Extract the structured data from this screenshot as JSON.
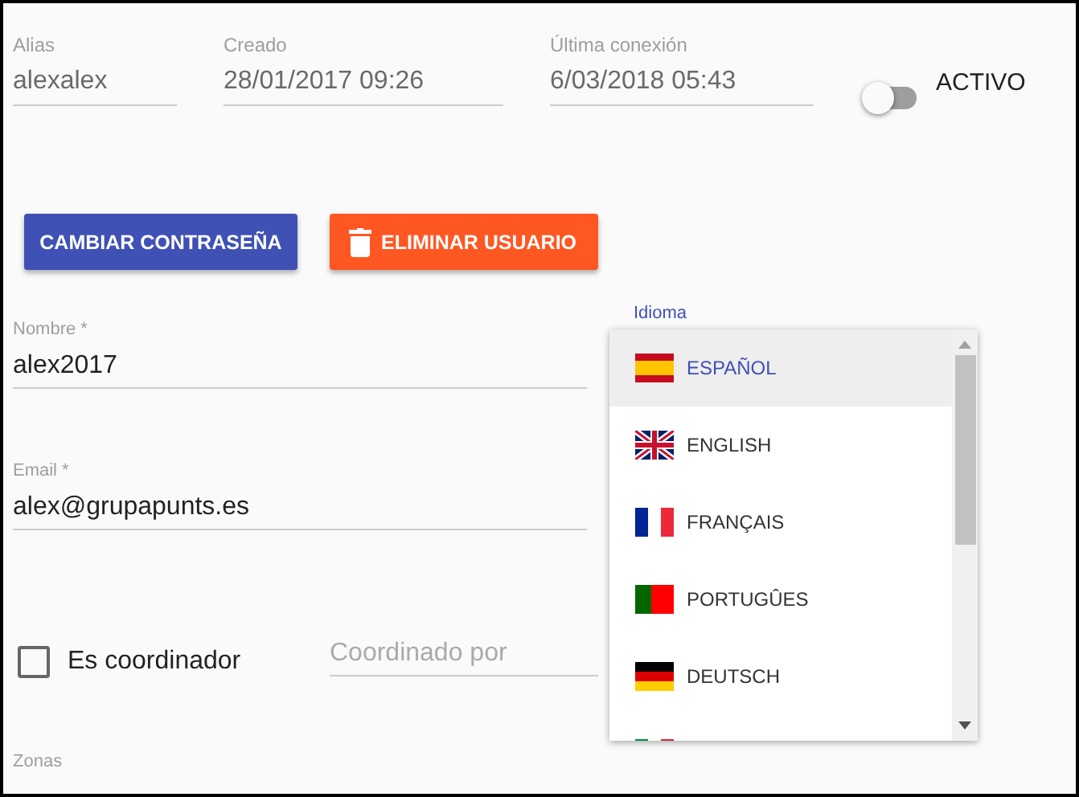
{
  "info_fields": [
    {
      "label": "Alias",
      "value": "alexalex"
    },
    {
      "label": "Creado",
      "value": "28/01/2017 09:26"
    },
    {
      "label": "Última conexión",
      "value": "6/03/2018 05:43"
    }
  ],
  "status_toggle": {
    "label": "ACTIVO",
    "on": false
  },
  "buttons": [
    {
      "kind": "primary",
      "label": "CAMBIAR CONTRASEÑA"
    },
    {
      "kind": "danger",
      "label": "ELIMINAR USUARIO"
    }
  ],
  "name_field": {
    "label": "Nombre *",
    "value": "alex2017"
  },
  "email_field": {
    "label": "Email *",
    "value": "alex@grupapunts.es"
  },
  "language_field": {
    "label": "Idioma"
  },
  "coordinator_checkbox": {
    "label": "Es coordinador",
    "checked": false
  },
  "coordinated_by": {
    "placeholder": "Coordinado por"
  },
  "zones_label": "Zonas",
  "language_menu": [
    {
      "kind": "es",
      "label": "ESPAÑOL",
      "selected": true
    },
    {
      "kind": "gb",
      "label": "ENGLISH",
      "selected": false
    },
    {
      "kind": "fr",
      "label": "FRANÇAIS",
      "selected": false
    },
    {
      "kind": "pt",
      "label": "PORTUGÛES",
      "selected": false
    },
    {
      "kind": "de",
      "label": "DEUTSCH",
      "selected": false
    },
    {
      "kind": "it",
      "selected": false
    }
  ]
}
